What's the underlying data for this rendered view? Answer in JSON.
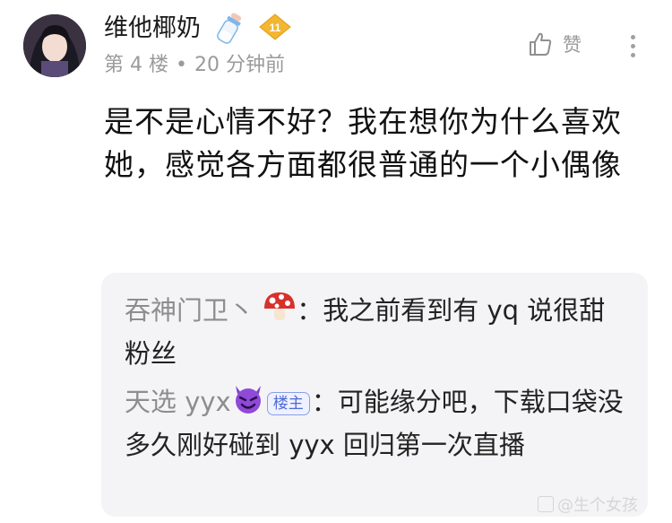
{
  "post": {
    "username": "维他椰奶",
    "level": "11",
    "floor": "第 4 楼",
    "separator": "•",
    "time": "20 分钟前",
    "like_label": "赞",
    "content": "是不是心情不好？我在想你为什么喜欢她，感觉各方面都很普通的一个小偶像"
  },
  "replies": [
    {
      "name": "吞神门卫丶",
      "name_icon": "mushroom-icon",
      "text": "：我之前看到有 yq 说很甜粉丝"
    },
    {
      "name": "天选 yyx",
      "name_icon": "purple-devil-icon",
      "badge": "楼主",
      "text": "：可能缘分吧，下载口袋没多久刚好碰到 yyx 回归第一次直播"
    }
  ],
  "watermark": "@生个女孩",
  "colors": {
    "meta_gray": "#9a9a9a",
    "reply_bg": "#f4f4f6",
    "op_badge_blue": "#4f6bd8",
    "level_gold": "#f2b632"
  }
}
